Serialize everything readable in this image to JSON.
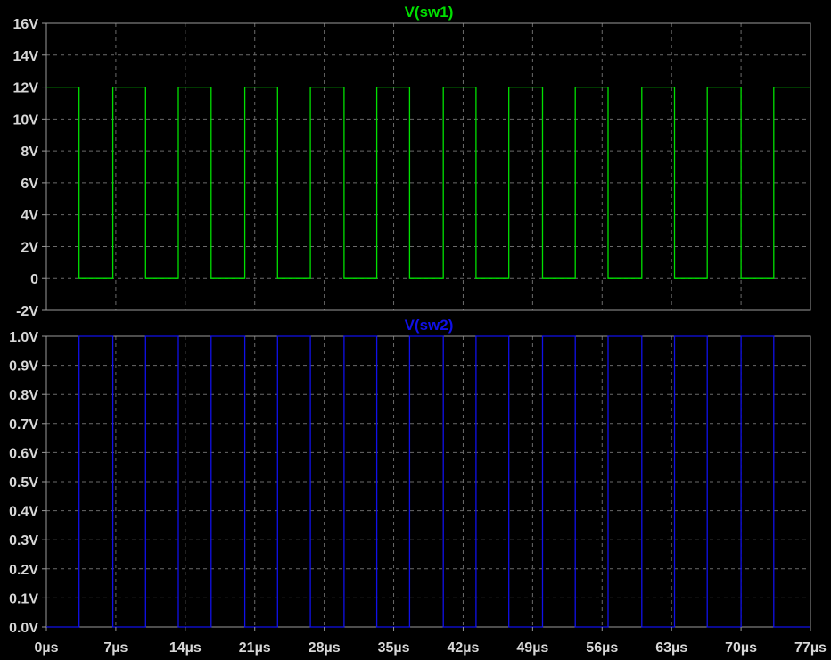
{
  "chart_data": [
    {
      "type": "line",
      "title": "V(sw1)",
      "color": "#00e000",
      "ylim": [
        -2,
        16
      ],
      "yticks": [
        16,
        14,
        12,
        10,
        8,
        6,
        4,
        2,
        0,
        -2
      ],
      "ytick_labels": [
        "16V",
        "14V",
        "12V",
        "10V",
        "8V",
        "6V",
        "4V",
        "2V",
        "0",
        "-2V"
      ],
      "xlim": [
        0,
        77
      ],
      "grid": true,
      "low": 0,
      "high": 12,
      "series": [
        {
          "x": [
            0,
            3.3,
            3.3,
            6.7,
            6.7,
            10.0,
            10.0,
            13.3,
            13.3,
            16.6,
            16.6,
            20.0,
            20.0,
            23.3,
            23.3,
            26.6,
            26.6,
            30.0,
            30.0,
            33.3,
            33.3,
            36.6,
            36.6,
            40.0,
            40.0,
            43.3,
            43.3,
            46.6,
            46.6,
            50.0,
            50.0,
            53.3,
            53.3,
            56.6,
            56.6,
            60.0,
            60.0,
            63.3,
            63.3,
            66.6,
            66.6,
            70.0,
            70.0,
            73.3,
            73.3,
            77.0
          ],
          "y": [
            12,
            12,
            0,
            0,
            12,
            12,
            0,
            0,
            12,
            12,
            0,
            0,
            12,
            12,
            0,
            0,
            12,
            12,
            0,
            0,
            12,
            12,
            0,
            0,
            12,
            12,
            0,
            0,
            12,
            12,
            0,
            0,
            12,
            12,
            0,
            0,
            12,
            12,
            0,
            0,
            12,
            12,
            0,
            0,
            12,
            12
          ]
        }
      ]
    },
    {
      "type": "line",
      "title": "V(sw2)",
      "color": "#1010e8",
      "ylim": [
        0,
        1
      ],
      "yticks": [
        1.0,
        0.9,
        0.8,
        0.7,
        0.6,
        0.5,
        0.4,
        0.3,
        0.2,
        0.1,
        0.0
      ],
      "ytick_labels": [
        "1.0V",
        "0.9V",
        "0.8V",
        "0.7V",
        "0.6V",
        "0.5V",
        "0.4V",
        "0.3V",
        "0.2V",
        "0.1V",
        "0.0V"
      ],
      "xlim": [
        0,
        77
      ],
      "xticks": [
        0,
        7,
        14,
        21,
        28,
        35,
        42,
        49,
        56,
        63,
        70,
        77
      ],
      "xtick_labels": [
        "0µs",
        "7µs",
        "14µs",
        "21µs",
        "28µs",
        "35µs",
        "42µs",
        "49µs",
        "56µs",
        "63µs",
        "70µs",
        "77µs"
      ],
      "grid": true,
      "low": 0,
      "high": 1,
      "series": [
        {
          "x": [
            0,
            3.3,
            3.3,
            6.7,
            6.7,
            10.0,
            10.0,
            13.3,
            13.3,
            16.6,
            16.6,
            20.0,
            20.0,
            23.3,
            23.3,
            26.6,
            26.6,
            30.0,
            30.0,
            33.3,
            33.3,
            36.6,
            36.6,
            40.0,
            40.0,
            43.3,
            43.3,
            46.6,
            46.6,
            50.0,
            50.0,
            53.3,
            53.3,
            56.6,
            56.6,
            60.0,
            60.0,
            63.3,
            63.3,
            66.6,
            66.6,
            70.0,
            70.0,
            73.3,
            73.3,
            77.0
          ],
          "y": [
            0,
            0,
            1,
            1,
            0,
            0,
            1,
            1,
            0,
            0,
            1,
            1,
            0,
            0,
            1,
            1,
            0,
            0,
            1,
            1,
            0,
            0,
            1,
            1,
            0,
            0,
            1,
            1,
            0,
            0,
            1,
            1,
            0,
            0,
            1,
            1,
            0,
            0,
            1,
            1,
            0,
            0,
            1,
            1,
            0,
            0
          ]
        }
      ]
    }
  ]
}
